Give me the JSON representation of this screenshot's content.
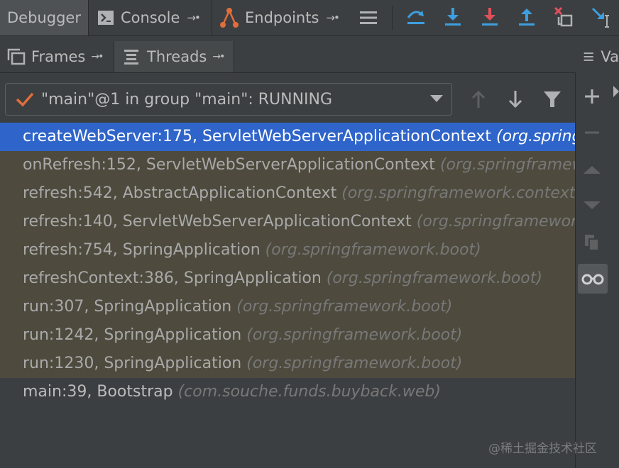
{
  "toolbar": {
    "debugger_tab": "Debugger",
    "console_tab": "Console",
    "endpoints_tab": "Endpoints",
    "pin": "→•"
  },
  "subtabs": {
    "frames": "Frames",
    "threads": "Threads",
    "variables": "Va"
  },
  "thread_selector": {
    "value": "\"main\"@1 in group \"main\": RUNNING"
  },
  "frames": [
    {
      "method": "createWebServer:175, ServletWebServerApplicationContext",
      "pkg": "(org.springframework.boot.web.servlet.context)",
      "kind": "selected"
    },
    {
      "method": "onRefresh:152, ServletWebServerApplicationContext",
      "pkg": "(org.springframework.boot.web.servlet.context)",
      "kind": "lib"
    },
    {
      "method": "refresh:542, AbstractApplicationContext",
      "pkg": "(org.springframework.context.support)",
      "kind": "lib"
    },
    {
      "method": "refresh:140, ServletWebServerApplicationContext",
      "pkg": "(org.springframework.boot.web.servlet.context)",
      "kind": "lib"
    },
    {
      "method": "refresh:754, SpringApplication",
      "pkg": "(org.springframework.boot)",
      "kind": "lib"
    },
    {
      "method": "refreshContext:386, SpringApplication",
      "pkg": "(org.springframework.boot)",
      "kind": "lib"
    },
    {
      "method": "run:307, SpringApplication",
      "pkg": "(org.springframework.boot)",
      "kind": "lib"
    },
    {
      "method": "run:1242, SpringApplication",
      "pkg": "(org.springframework.boot)",
      "kind": "lib"
    },
    {
      "method": "run:1230, SpringApplication",
      "pkg": "(org.springframework.boot)",
      "kind": "lib"
    },
    {
      "method": "main:39, Bootstrap",
      "pkg": "(com.souche.funds.buyback.web)",
      "kind": "user"
    }
  ],
  "watermark": "@稀土掘金技术社区",
  "colors": {
    "selection": "#2f65ca",
    "library_frame_bg": "#4e4a3e",
    "step_blue": "#3d9fe0",
    "step_red": "#e0505b",
    "check_orange": "#e26d3b"
  }
}
